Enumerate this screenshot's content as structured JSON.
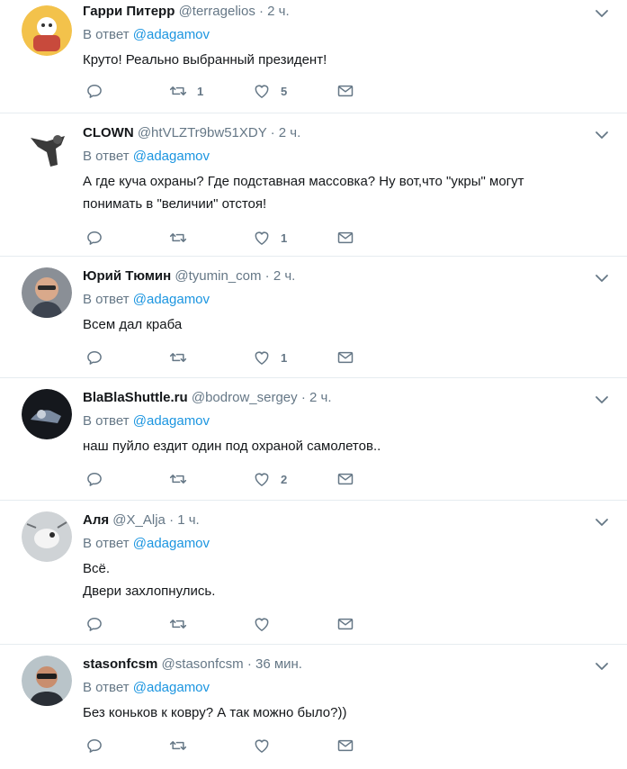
{
  "tweets": [
    {
      "name": "Гарри Питерр",
      "handle": "@terragelios",
      "dot": "·",
      "time": "2 ч.",
      "reply_prefix": "В ответ",
      "reply_to": "@adagamov",
      "text": "Круто! Реально выбранный президент!",
      "retweets": "1",
      "likes": "5"
    },
    {
      "name": "CLOWN",
      "handle": "@htVLZTr9bw51XDY",
      "dot": "·",
      "time": "2 ч.",
      "reply_prefix": "В ответ",
      "reply_to": "@adagamov",
      "text": "А где куча охраны? Где подставная массовка? Ну вот,что \"укры\" могут понимать в \"величии\" отстоя!",
      "retweets": "",
      "likes": "1"
    },
    {
      "name": "Юрий Тюмин",
      "handle": "@tyumin_com",
      "dot": "·",
      "time": "2 ч.",
      "reply_prefix": "В ответ",
      "reply_to": "@adagamov",
      "text": "Всем дал краба",
      "retweets": "",
      "likes": "1"
    },
    {
      "name": "BlaBlaShuttle.ru",
      "handle": "@bodrow_sergey",
      "dot": "·",
      "time": "2 ч.",
      "reply_prefix": "В ответ",
      "reply_to": "@adagamov",
      "text": "наш пуйло ездит один под охраной самолетов..",
      "retweets": "",
      "likes": "2"
    },
    {
      "name": "Аля",
      "handle": "@X_Alja",
      "dot": "·",
      "time": "1 ч.",
      "reply_prefix": "В ответ",
      "reply_to": "@adagamov",
      "text": "Всё.\nДвери захлопнулись.",
      "retweets": "",
      "likes": ""
    },
    {
      "name": "stasonfcsm",
      "handle": "@stasonfcsm",
      "dot": "·",
      "time": "36 мин.",
      "reply_prefix": "В ответ",
      "reply_to": "@adagamov",
      "text": "Без коньков к ковру? А так можно было?))",
      "retweets": "",
      "likes": ""
    }
  ],
  "icons": {
    "reply": "reply-icon",
    "retweet": "retweet-icon",
    "like": "heart-icon",
    "dm": "envelope-icon",
    "more": "chevron-down-icon"
  },
  "colors": {
    "secondary_text": "#657786",
    "mention": "#1b95e0",
    "divider": "#e6ecf0"
  }
}
